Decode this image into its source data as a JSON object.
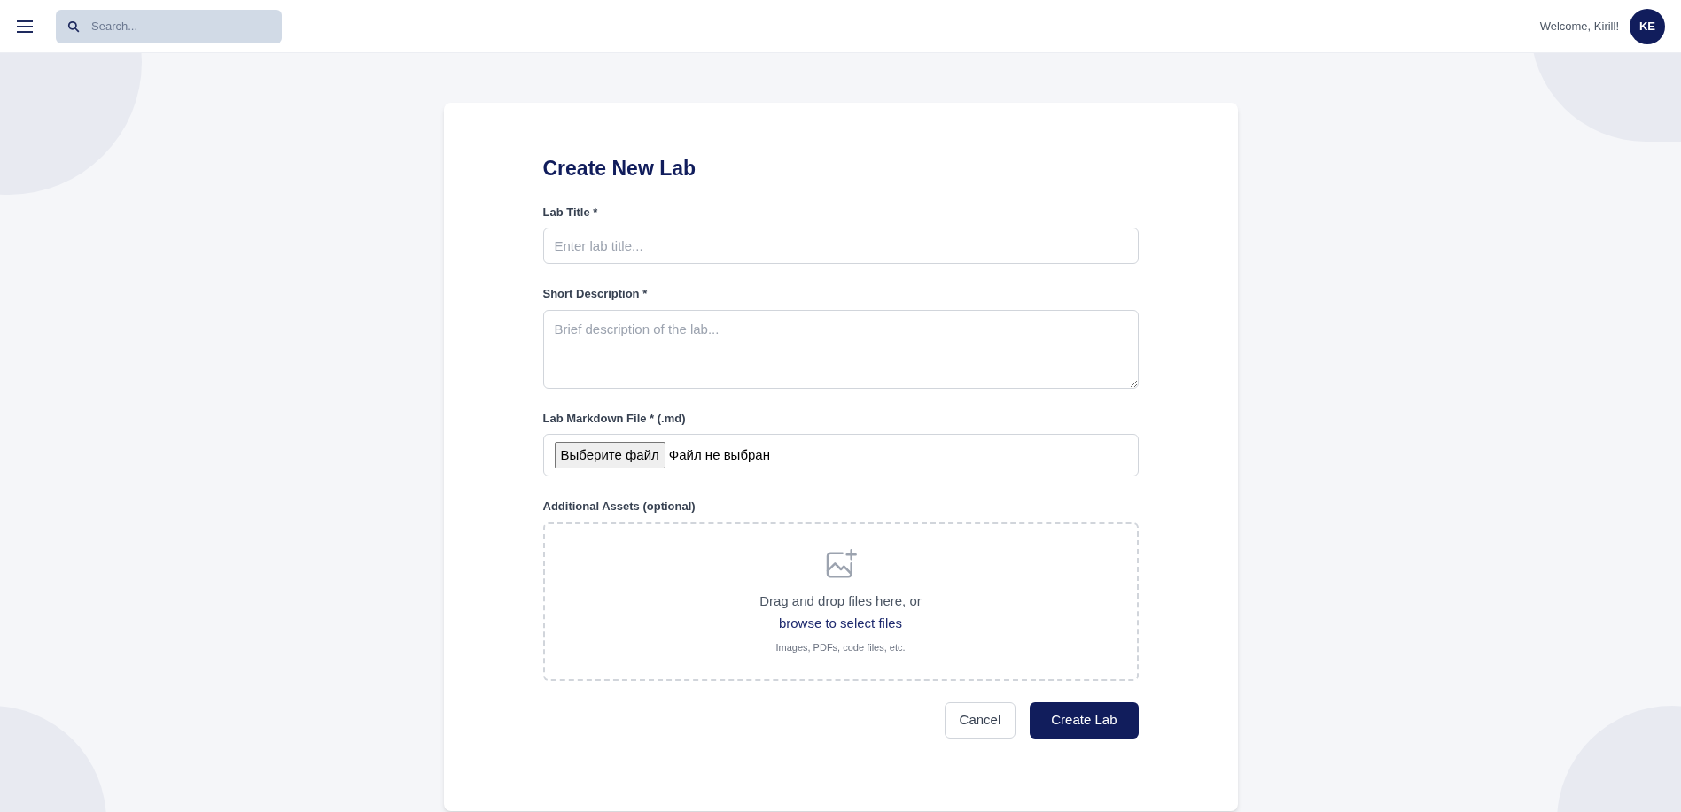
{
  "header": {
    "search": {
      "placeholder": "Search..."
    },
    "welcome": "Welcome, Kirill!",
    "avatar": "KE"
  },
  "form": {
    "title": "Create New Lab",
    "fields": [
      {
        "kind": "input",
        "label": "Lab Title *",
        "placeholder": "Enter lab title..."
      },
      {
        "kind": "textarea",
        "label": "Short Description *",
        "placeholder": "Brief description of the lab..."
      },
      {
        "kind": "file",
        "label": "Lab Markdown File * (.md)",
        "button": "Выберите файл",
        "status": "Файл не выбран"
      },
      {
        "kind": "dropzone",
        "label": "Additional Assets (optional)",
        "text": "Drag and drop files here, or",
        "link": "browse to select files",
        "hint": "Images, PDFs, code files, etc."
      }
    ],
    "buttons": [
      {
        "kind": "secondary",
        "label": "Cancel"
      },
      {
        "kind": "primary",
        "label": "Create Lab"
      }
    ]
  }
}
